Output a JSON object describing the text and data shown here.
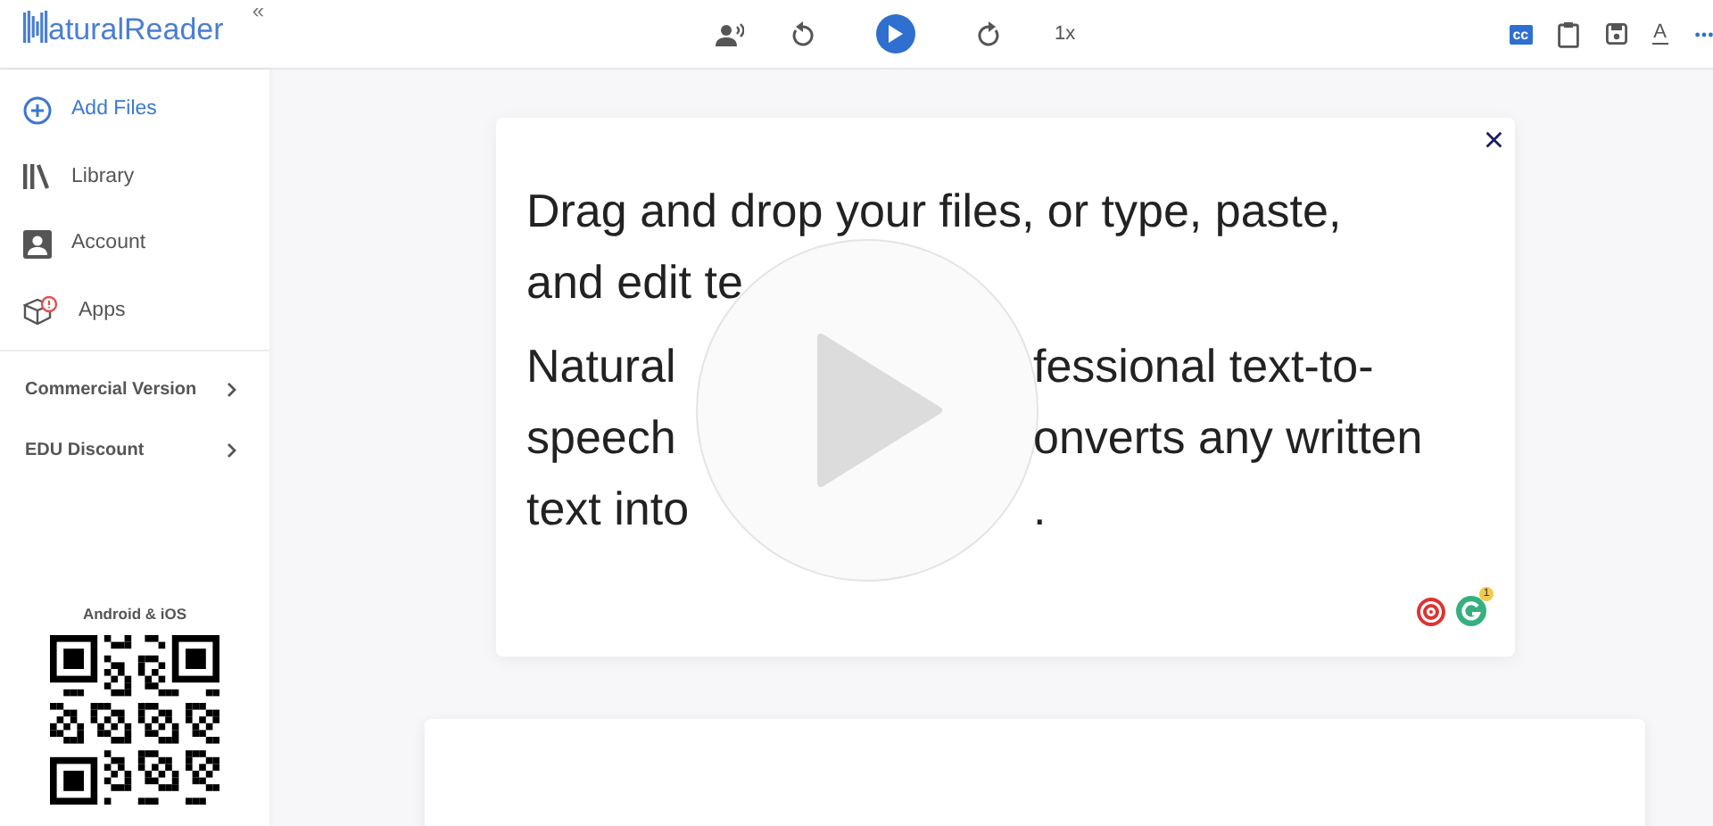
{
  "app": {
    "logo": "aturalReader",
    "collapse": "«"
  },
  "toolbar": {
    "speed": "1x",
    "cc": "cc",
    "font": "A"
  },
  "sidebar": {
    "items": [
      {
        "label": "Add Files",
        "kind": "add"
      },
      {
        "label": "Library",
        "kind": "library"
      },
      {
        "label": "Account",
        "kind": "account"
      },
      {
        "label": "Apps",
        "kind": "apps"
      }
    ],
    "links": [
      {
        "label": "Commercial Version"
      },
      {
        "label": "EDU Discount"
      }
    ],
    "qr_caption": "Android & iOS"
  },
  "editor": {
    "close": "×",
    "badge": "1",
    "paragraphs": [
      [
        {
          "left": "Drag and drop your files, or type, paste,"
        },
        {
          "left": "and edit te"
        }
      ],
      [
        {
          "left": "Natural",
          "right": "fessional text-to-"
        },
        {
          "left": "speech",
          "right": "onverts any written"
        },
        {
          "left": "text into",
          "right": "."
        }
      ]
    ]
  }
}
